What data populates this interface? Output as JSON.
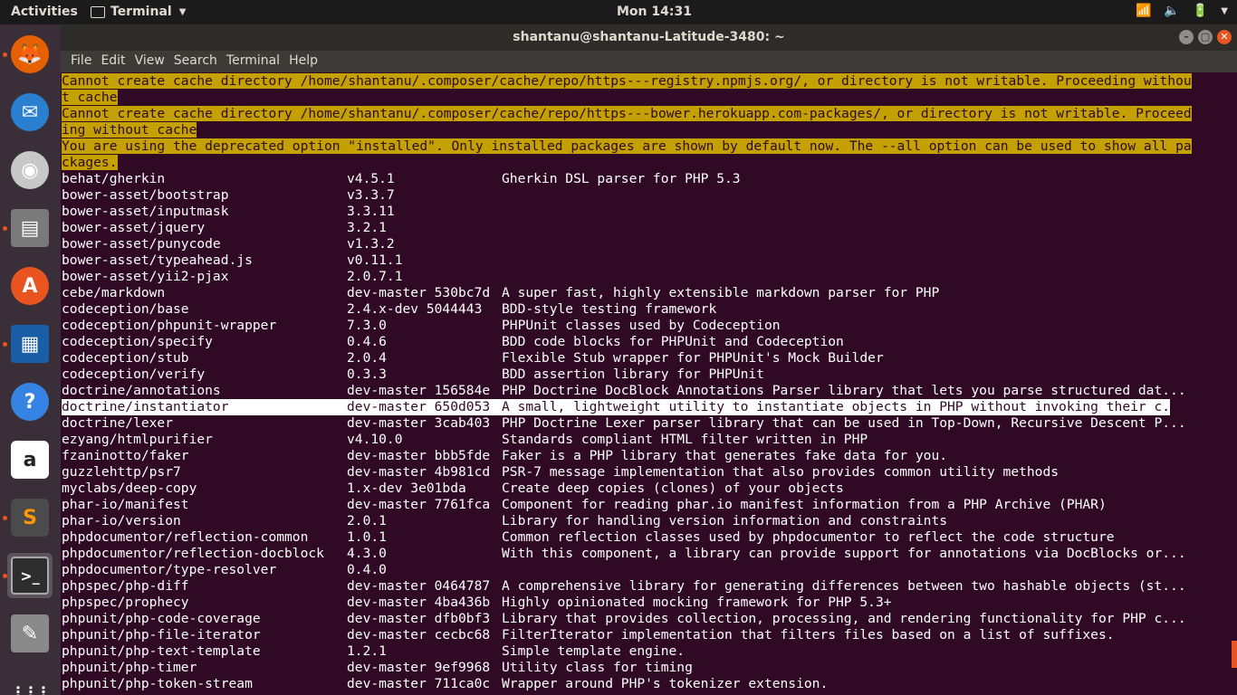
{
  "topbar": {
    "activities": "Activities",
    "app_name": "Terminal",
    "clock": "Mon 14:31"
  },
  "window": {
    "title": "shantanu@shantanu-Latitude-3480: ~"
  },
  "menu": [
    "File",
    "Edit",
    "View",
    "Search",
    "Terminal",
    "Help"
  ],
  "dock": [
    {
      "name": "firefox",
      "glyph": "🦊",
      "running": true
    },
    {
      "name": "thunderbird",
      "glyph": "✉",
      "running": false
    },
    {
      "name": "rhythmbox",
      "glyph": "◉",
      "running": false
    },
    {
      "name": "files",
      "glyph": "▤",
      "running": true
    },
    {
      "name": "software",
      "glyph": "A",
      "running": false
    },
    {
      "name": "writer",
      "glyph": "▦",
      "running": true
    },
    {
      "name": "help",
      "glyph": "?",
      "running": false
    },
    {
      "name": "amazon",
      "glyph": "a",
      "running": false
    },
    {
      "name": "sublime",
      "glyph": "S",
      "running": true
    },
    {
      "name": "terminal",
      "glyph": ">_",
      "running": true
    },
    {
      "name": "editor",
      "glyph": "✎",
      "running": false
    },
    {
      "name": "apps",
      "glyph": "⋮⋮⋮",
      "running": false
    }
  ],
  "warnings": [
    "Cannot create cache directory /home/shantanu/.composer/cache/repo/https---registry.npmjs.org/, or directory is not writable. Proceeding withou",
    "t cache",
    "Cannot create cache directory /home/shantanu/.composer/cache/repo/https---bower.herokuapp.com-packages/, or directory is not writable. Proceed",
    "ing without cache",
    "You are using the deprecated option \"installed\". Only installed packages are shown by default now. The --all option can be used to show all pa",
    "ckages."
  ],
  "packages": [
    {
      "name": "behat/gherkin",
      "version": "v4.5.1",
      "desc": "Gherkin DSL parser for PHP 5.3"
    },
    {
      "name": "bower-asset/bootstrap",
      "version": "v3.3.7",
      "desc": ""
    },
    {
      "name": "bower-asset/inputmask",
      "version": "3.3.11",
      "desc": ""
    },
    {
      "name": "bower-asset/jquery",
      "version": "3.2.1",
      "desc": ""
    },
    {
      "name": "bower-asset/punycode",
      "version": "v1.3.2",
      "desc": ""
    },
    {
      "name": "bower-asset/typeahead.js",
      "version": "v0.11.1",
      "desc": ""
    },
    {
      "name": "bower-asset/yii2-pjax",
      "version": "2.0.7.1",
      "desc": ""
    },
    {
      "name": "cebe/markdown",
      "version": "dev-master 530bc7d",
      "desc": "A super fast, highly extensible markdown parser for PHP"
    },
    {
      "name": "codeception/base",
      "version": "2.4.x-dev 5044443",
      "desc": "BDD-style testing framework"
    },
    {
      "name": "codeception/phpunit-wrapper",
      "version": "7.3.0",
      "desc": "PHPUnit classes used by Codeception"
    },
    {
      "name": "codeception/specify",
      "version": "0.4.6",
      "desc": "BDD code blocks for PHPUnit and Codeception"
    },
    {
      "name": "codeception/stub",
      "version": "2.0.4",
      "desc": "Flexible Stub wrapper for PHPUnit's Mock Builder"
    },
    {
      "name": "codeception/verify",
      "version": "0.3.3",
      "desc": "BDD assertion library for PHPUnit"
    },
    {
      "name": "doctrine/annotations",
      "version": "dev-master 156584e",
      "desc": "PHP Doctrine DocBlock Annotations Parser library that lets you parse structured dat..."
    },
    {
      "name": "doctrine/instantiator",
      "version": "dev-master 650d053",
      "desc": "A small, lightweight utility to instantiate objects in PHP without invoking their c...",
      "selected": true
    },
    {
      "name": "doctrine/lexer",
      "version": "dev-master 3cab403",
      "desc": "PHP Doctrine Lexer parser library that can be used in Top-Down, Recursive Descent P..."
    },
    {
      "name": "ezyang/htmlpurifier",
      "version": "v4.10.0",
      "desc": "Standards compliant HTML filter written in PHP"
    },
    {
      "name": "fzaninotto/faker",
      "version": "dev-master bbb5fde",
      "desc": "Faker is a PHP library that generates fake data for you."
    },
    {
      "name": "guzzlehttp/psr7",
      "version": "dev-master 4b981cd",
      "desc": "PSR-7 message implementation that also provides common utility methods"
    },
    {
      "name": "myclabs/deep-copy",
      "version": "1.x-dev 3e01bda",
      "desc": "Create deep copies (clones) of your objects"
    },
    {
      "name": "phar-io/manifest",
      "version": "dev-master 7761fca",
      "desc": "Component for reading phar.io manifest information from a PHP Archive (PHAR)"
    },
    {
      "name": "phar-io/version",
      "version": "2.0.1",
      "desc": "Library for handling version information and constraints"
    },
    {
      "name": "phpdocumentor/reflection-common",
      "version": "1.0.1",
      "desc": "Common reflection classes used by phpdocumentor to reflect the code structure"
    },
    {
      "name": "phpdocumentor/reflection-docblock",
      "version": "4.3.0",
      "desc": "With this component, a library can provide support for annotations via DocBlocks or..."
    },
    {
      "name": "phpdocumentor/type-resolver",
      "version": "0.4.0",
      "desc": ""
    },
    {
      "name": "phpspec/php-diff",
      "version": "dev-master 0464787",
      "desc": "A comprehensive library for generating differences between two hashable objects (st..."
    },
    {
      "name": "phpspec/prophecy",
      "version": "dev-master 4ba436b",
      "desc": "Highly opinionated mocking framework for PHP 5.3+"
    },
    {
      "name": "phpunit/php-code-coverage",
      "version": "dev-master dfb0bf3",
      "desc": "Library that provides collection, processing, and rendering functionality for PHP c..."
    },
    {
      "name": "phpunit/php-file-iterator",
      "version": "dev-master cecbc68",
      "desc": "FilterIterator implementation that filters files based on a list of suffixes."
    },
    {
      "name": "phpunit/php-text-template",
      "version": "1.2.1",
      "desc": "Simple template engine."
    },
    {
      "name": "phpunit/php-timer",
      "version": "dev-master 9ef9968",
      "desc": "Utility class for timing"
    },
    {
      "name": "phpunit/php-token-stream",
      "version": "dev-master 711ca0c",
      "desc": "Wrapper around PHP's tokenizer extension."
    }
  ]
}
